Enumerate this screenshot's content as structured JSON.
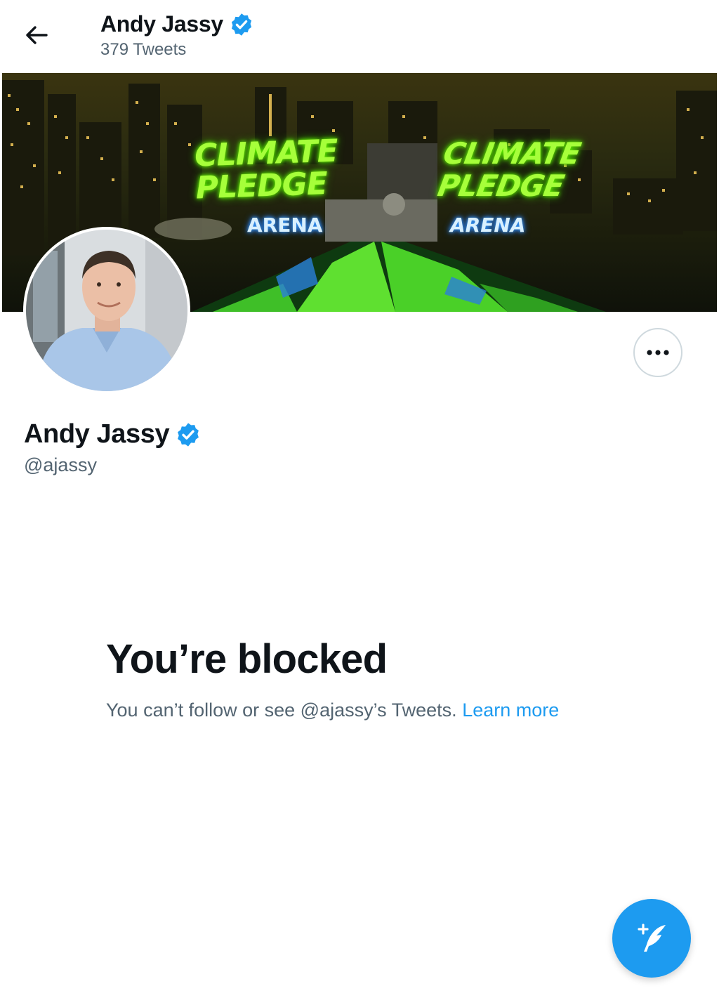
{
  "header": {
    "title": "Andy Jassy",
    "tweet_count": "379 Tweets"
  },
  "banner": {
    "sign_left": {
      "line1": "CLIMATE",
      "line2": "PLEDGE",
      "line3": "ARENA"
    },
    "sign_right": {
      "line1": "CLIMATE",
      "line2": "PLEDGE",
      "line3": "ARENA"
    }
  },
  "profile": {
    "name": "Andy Jassy",
    "handle": "@ajassy"
  },
  "blocked": {
    "title": "You’re blocked",
    "message": "You can’t follow or see @ajassy’s Tweets.",
    "link": "Learn more"
  },
  "icons": {
    "back": "arrow-left-icon",
    "verified": "verified-badge-icon",
    "more": "more-horizontal-icon",
    "compose": "compose-tweet-icon"
  },
  "colors": {
    "accent": "#1d9bf0",
    "text_primary": "#0f1419",
    "text_secondary": "#536471",
    "sign_green": "#a6ff3a",
    "sign_blue": "#3aa0ff"
  }
}
